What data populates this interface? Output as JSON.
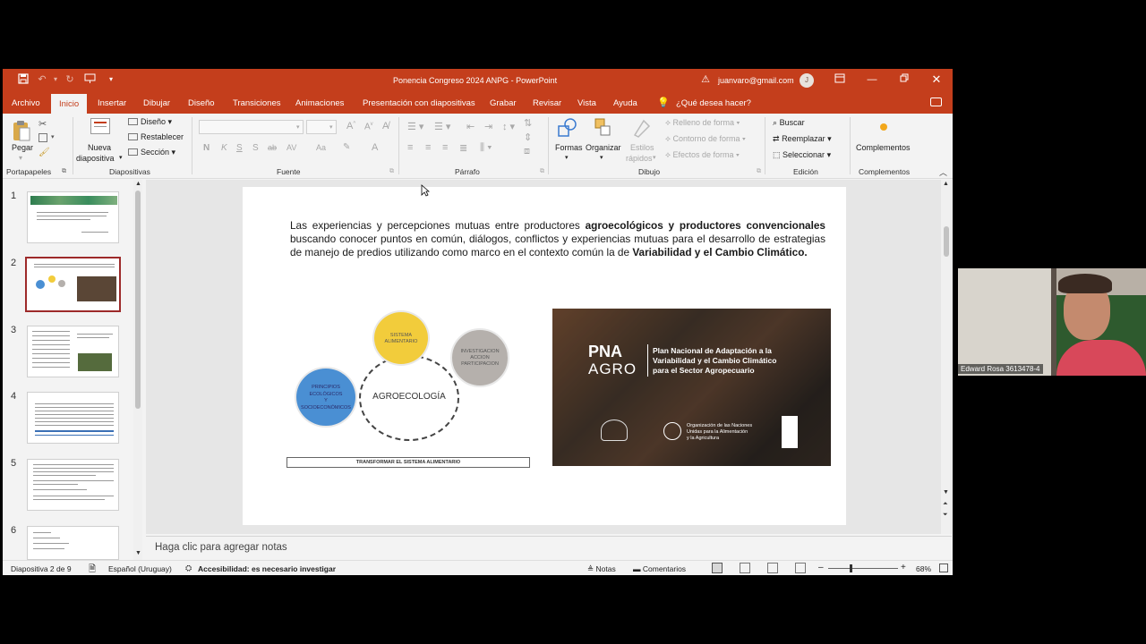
{
  "titlebar": {
    "doc_title": "Ponencia Congreso 2024 ANPG  -  PowerPoint",
    "account_email": "juanvaro@gmail.com",
    "account_initial": "J"
  },
  "tabs": [
    "Archivo",
    "Inicio",
    "Insertar",
    "Dibujar",
    "Diseño",
    "Transiciones",
    "Animaciones",
    "Presentación con diapositivas",
    "Grabar",
    "Revisar",
    "Vista",
    "Ayuda"
  ],
  "tell_me": "¿Qué desea hacer?",
  "ribbon": {
    "paste": "Pegar",
    "portapapeles": "Portapapeles",
    "new_slide_1": "Nueva",
    "new_slide_2": "diapositiva",
    "diseno": "Diseño",
    "restablecer": "Restablecer",
    "seccion": "Sección",
    "diapositivas": "Diapositivas",
    "fuente": "Fuente",
    "parrafo": "Párrafo",
    "formas": "Formas",
    "organizar": "Organizar",
    "estilos_1": "Estilos",
    "estilos_2": "rápidos",
    "relleno": "Relleno de forma",
    "contorno": "Contorno de forma",
    "efectos": "Efectos de forma",
    "dibujo": "Dibujo",
    "buscar": "Buscar",
    "reemplazar": "Reemplazar",
    "seleccionar": "Seleccionar",
    "edicion": "Edición",
    "complementos_btn": "Complementos",
    "complementos": "Complementos",
    "font_bold": "N",
    "font_italic": "K",
    "font_underline": "S",
    "font_strike": "S",
    "font_ab": "ab",
    "font_aa": "Aa",
    "font_a": "A"
  },
  "thumbnails": [
    "1",
    "2",
    "3",
    "4",
    "5",
    "6"
  ],
  "slide": {
    "text_1": "Las experiencias y percepciones mutuas entre productores ",
    "text_bold_1": "agroecológicos y productores convencionales",
    "text_2": " buscando conocer puntos en común, diálogos, conflictos y experiencias mutuas para el desarrollo de estrategias de manejo de predios utilizando como marco en el contexto común la de ",
    "text_bold_2": "Variabilidad y el Cambio Climático.",
    "diagram": {
      "center": "AGROECOLOGÍA",
      "yellow_1": "SISTEMA",
      "yellow_2": "ALIMENTARIO",
      "gray_1": "INVESTIGACION",
      "gray_2": "ACCION",
      "gray_3": "PARTICIPACION",
      "blue_1": "PRINCIPIOS",
      "blue_2": "ECOLÓGICOS",
      "blue_3": "Y",
      "blue_4": "SOCIOECONÓMICOS",
      "bar": "TRANSFORMAR EL SISTEMA ALIMENTARIO"
    },
    "image": {
      "pna": "PNA",
      "agro": "AGRO",
      "title_1": "Plan Nacional de Adaptación a la",
      "title_2": "Variabilidad y el Cambio Climático",
      "title_3": "para el Sector Agropecuario",
      "fao_1": "Organización de las Naciones",
      "fao_2": "Unidas para la Alimentación",
      "fao_3": "y la Agricultura"
    }
  },
  "notes_placeholder": "Haga clic para agregar notas",
  "status": {
    "slide_of": "Diapositiva 2 de 9",
    "language": "Español (Uruguay)",
    "accessibility": "Accesibilidad: es necesario investigar",
    "notas": "Notas",
    "comentarios": "Comentarios",
    "zoom": "68%"
  },
  "video": {
    "participant": "Edward Rosa 3613478-4"
  },
  "colors": {
    "accent": "#c43e1c",
    "selected_thumb": "#9d2a2a",
    "yellow": "#f2cc3b",
    "blue": "#4a8fd3",
    "gray": "#b5b0ac"
  }
}
